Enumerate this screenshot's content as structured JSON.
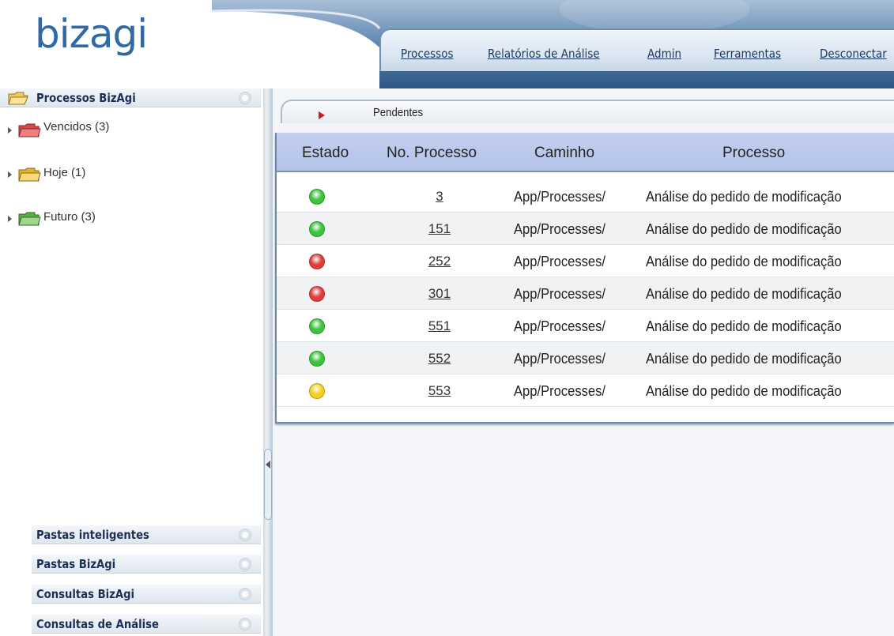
{
  "header": {
    "logo": "bizagi",
    "nav": [
      {
        "label": "Processos"
      },
      {
        "label": "Relatórios de Análise"
      },
      {
        "label": "Admin"
      },
      {
        "label": "Ferramentas"
      },
      {
        "label": "Desconectar"
      }
    ]
  },
  "sidebar": {
    "title": "Processos BizAgi",
    "items": [
      {
        "label": "Vencidos (3)",
        "folder_color": "#d9474b",
        "icon": "red-folder-icon"
      },
      {
        "label": "Hoje (1)",
        "folder_color": "#e2b12f",
        "icon": "yellow-folder-icon"
      },
      {
        "label": "Futuro (3)",
        "folder_color": "#5cad4a",
        "icon": "green-folder-icon"
      }
    ],
    "bottom_panels": [
      {
        "label": "Pastas inteligentes"
      },
      {
        "label": "Pastas BizAgi"
      },
      {
        "label": "Consultas BizAgi"
      },
      {
        "label": "Consultas de Análise"
      }
    ]
  },
  "main": {
    "breadcrumb": "Pendentes",
    "table": {
      "columns": [
        "Estado",
        "No. Processo",
        "Caminho",
        "Processo"
      ],
      "rows": [
        {
          "status": "green",
          "number": "3",
          "path": "App/Processes/",
          "process": "Análise do pedido de modificação"
        },
        {
          "status": "green",
          "number": "151",
          "path": "App/Processes/",
          "process": "Análise do pedido de modificação"
        },
        {
          "status": "red",
          "number": "252",
          "path": "App/Processes/",
          "process": "Análise do pedido de modificação"
        },
        {
          "status": "red",
          "number": "301",
          "path": "App/Processes/",
          "process": "Análise do pedido de modificação"
        },
        {
          "status": "green",
          "number": "551",
          "path": "App/Processes/",
          "process": "Análise do pedido de modificação"
        },
        {
          "status": "green",
          "number": "552",
          "path": "App/Processes/",
          "process": "Análise do pedido de modificação"
        },
        {
          "status": "yellow",
          "number": "553",
          "path": "App/Processes/",
          "process": "Análise do pedido de modificação"
        }
      ]
    }
  },
  "colors": {
    "brand": "#2f6aa6",
    "status_green": "#3cc43c",
    "status_red": "#e03c3c",
    "status_yellow": "#f2d21c",
    "header_row": "#b9c6ec"
  }
}
